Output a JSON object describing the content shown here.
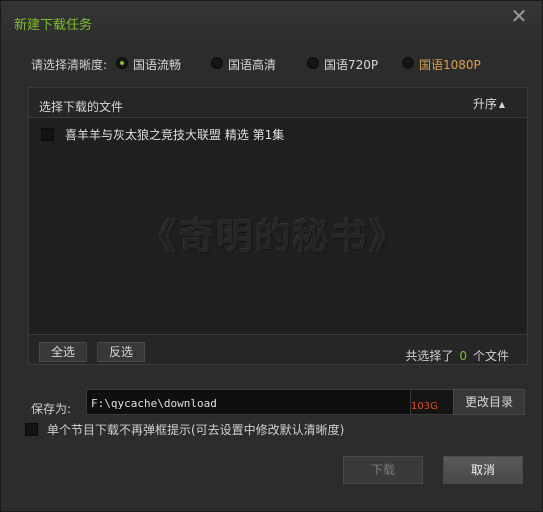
{
  "window": {
    "title": "新建下载任务",
    "close_icon": "close-icon"
  },
  "quality": {
    "label": "请选择清晰度:",
    "options": [
      {
        "label": "国语流畅",
        "selected": true
      },
      {
        "label": "国语高清",
        "selected": false
      },
      {
        "label": "国语720P",
        "selected": false
      },
      {
        "label": "国语1080P",
        "selected": false,
        "color": "#d9a052"
      }
    ]
  },
  "file_panel": {
    "header_label": "选择下载的文件",
    "sort_label": "升序",
    "sort_icon": "triangle-up-icon",
    "files": [
      {
        "name": "喜羊羊与灰太狼之竞技大联盟 精选 第1集",
        "checked": false
      }
    ],
    "watermark": "《奇明的秘书》",
    "select_all_label": "全选",
    "invert_label": "反选",
    "count_prefix": "共选择了",
    "count_value": "0",
    "count_suffix": "个文件"
  },
  "save": {
    "label": "保存为:",
    "path": "F:\\qycache\\download",
    "free_space": "103G",
    "change_dir_label": "更改目录"
  },
  "no_prompt": {
    "label": "单个节目下载不再弹框提示(可去设置中修改默认清晰度)",
    "checked": false
  },
  "buttons": {
    "download_label": "下载",
    "cancel_label": "取消"
  },
  "colors": {
    "accent_green": "#7fbf2e",
    "free_space_red": "#e04a2a",
    "gold_option": "#d9a052"
  }
}
